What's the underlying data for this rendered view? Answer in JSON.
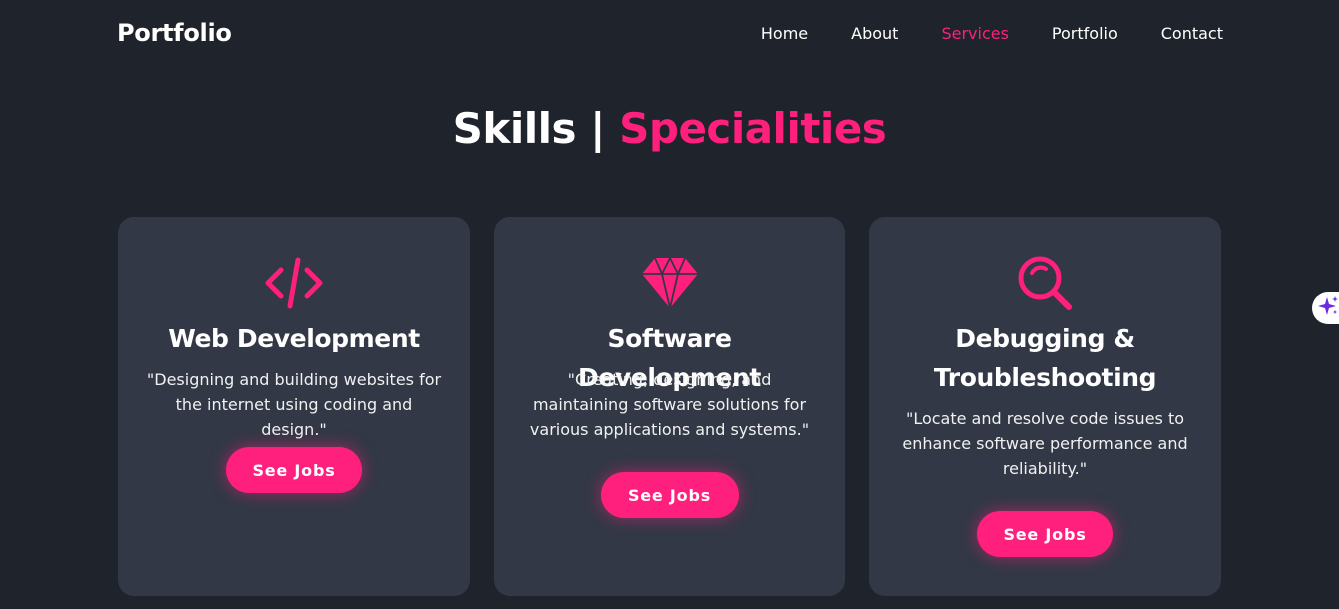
{
  "header": {
    "logo": "Portfolio",
    "nav": [
      {
        "label": "Home",
        "active": false
      },
      {
        "label": "About",
        "active": false
      },
      {
        "label": "Services",
        "active": true
      },
      {
        "label": "Portfolio",
        "active": false
      },
      {
        "label": "Contact",
        "active": false
      }
    ]
  },
  "section": {
    "title_main": "Skills | ",
    "title_accent": "Specialities"
  },
  "cards": [
    {
      "icon": "code-icon",
      "title": "Web Development",
      "description": "\"Designing and building websites for the internet using coding and design.\"",
      "button": "See Jobs"
    },
    {
      "icon": "gem-icon",
      "title": "Software Development",
      "description": "\"Creating, designing, and maintaining software solutions for various applications and systems.\"",
      "button": "See Jobs"
    },
    {
      "icon": "search-icon",
      "title": "Debugging & Troubleshooting",
      "description": "\"Locate and resolve code issues to enhance software performance and reliability.\"",
      "button": "See Jobs"
    }
  ],
  "side_widget": {
    "icon": "sparkle-icon"
  },
  "colors": {
    "background": "#1f232b",
    "card": "#323846",
    "accent": "#ff1f7d",
    "text": "#ffffff",
    "widget_icon": "#6a2ce0"
  }
}
